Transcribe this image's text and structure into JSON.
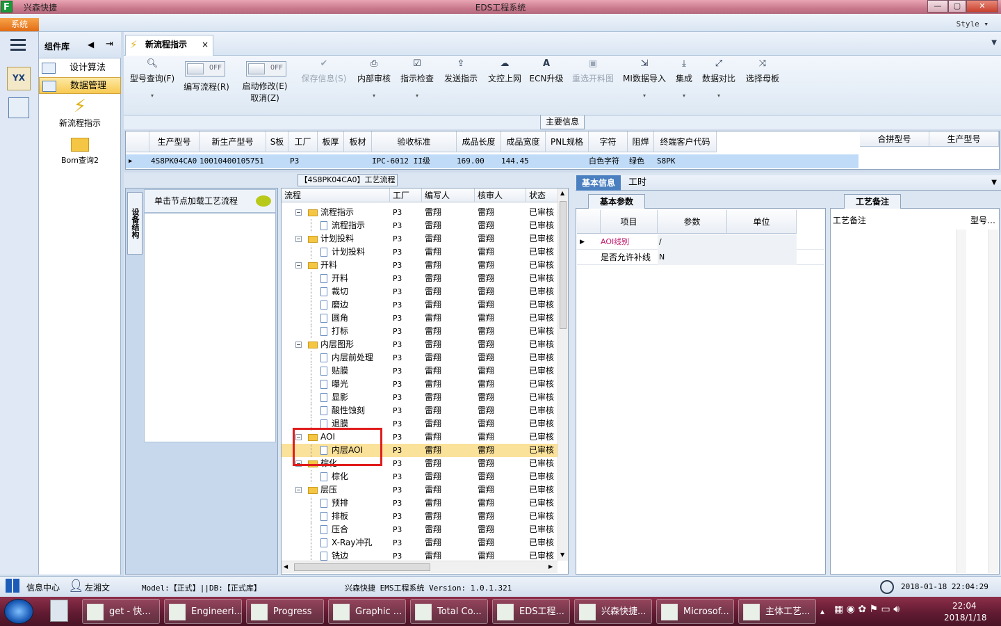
{
  "window": {
    "app_title": "兴森快捷",
    "title": "EDS工程系统",
    "controls": {
      "min": "—",
      "max": "▢",
      "close": "✕"
    }
  },
  "menu": {
    "system": "系统",
    "style": "Style"
  },
  "sidebar": {
    "header": "组件库",
    "items": [
      {
        "label": "设计算法"
      },
      {
        "label": "数据管理"
      }
    ],
    "big_items": [
      {
        "label": "新流程指示"
      },
      {
        "label": "Bom查询2"
      }
    ]
  },
  "tab": {
    "label": "新流程指示",
    "close": "×"
  },
  "toolbar": {
    "buttons": [
      {
        "label": "型号查询(F)",
        "icon": "search-icon",
        "arrow": "▾"
      },
      {
        "label": "编写流程(R)",
        "toggle": "OFF"
      },
      {
        "label": "启动修改(E)",
        "label2": "取消(Z)",
        "toggle": "OFF"
      },
      {
        "label": "保存信息(S)",
        "icon": "check-icon"
      },
      {
        "label": "内部审核",
        "icon": "print-icon",
        "arrow": "▾"
      },
      {
        "label": "指示检查",
        "icon": "checkbox-icon",
        "arrow": "▾"
      },
      {
        "label": "发送指示",
        "icon": "upload-icon"
      },
      {
        "label": "文控上网",
        "icon": "cloud-upload-icon"
      },
      {
        "label": "ECN升级",
        "icon": "font-icon"
      },
      {
        "label": "重选开料图",
        "icon": "image-icon"
      },
      {
        "label": "MI数据导入",
        "icon": "import-icon",
        "arrow": "▾"
      },
      {
        "label": "集成",
        "icon": "download-icon",
        "arrow": "▾"
      },
      {
        "label": "数据对比",
        "icon": "compare-icon",
        "arrow": "▾"
      },
      {
        "label": "选择母板",
        "icon": "shuffle-icon"
      }
    ]
  },
  "main_info": {
    "title": "主要信息",
    "columns": [
      "生产型号",
      "新生产型号",
      "S板",
      "工厂",
      "板厚",
      "板材",
      "验收标准",
      "成品长度",
      "成品宽度",
      "PNL规格",
      "字符",
      "阻焊",
      "终端客户代码"
    ],
    "row": [
      "4S8PK04CA0",
      "10010400105751",
      "",
      "P3",
      "",
      "",
      "IPC-6012 II级",
      "169.00",
      "144.45",
      "",
      "白色字符",
      "绿色",
      "S8PK"
    ],
    "side_columns": [
      "合拼型号",
      "生产型号"
    ]
  },
  "left_pane": {
    "vertical_tab": "设备结构",
    "load_hint": "单击节点加载工艺流程"
  },
  "process": {
    "title": "【4S8PK04CA0】工艺流程",
    "columns": [
      "流程",
      "工厂",
      "编写人",
      "核审人",
      "状态"
    ],
    "rows": [
      {
        "name": "流程指示",
        "level": 0,
        "factory": "P3",
        "writer": "雷翔",
        "reviewer": "雷翔",
        "status": "已审核"
      },
      {
        "name": "流程指示",
        "level": 1,
        "factory": "P3",
        "writer": "雷翔",
        "reviewer": "雷翔",
        "status": "已审核"
      },
      {
        "name": "计划投料",
        "level": 0,
        "factory": "P3",
        "writer": "雷翔",
        "reviewer": "雷翔",
        "status": "已审核"
      },
      {
        "name": "计划投料",
        "level": 1,
        "factory": "P3",
        "writer": "雷翔",
        "reviewer": "雷翔",
        "status": "已审核"
      },
      {
        "name": "开料",
        "level": 0,
        "factory": "P3",
        "writer": "雷翔",
        "reviewer": "雷翔",
        "status": "已审核"
      },
      {
        "name": "开料",
        "level": 1,
        "factory": "P3",
        "writer": "雷翔",
        "reviewer": "雷翔",
        "status": "已审核"
      },
      {
        "name": "裁切",
        "level": 1,
        "factory": "P3",
        "writer": "雷翔",
        "reviewer": "雷翔",
        "status": "已审核"
      },
      {
        "name": "磨边",
        "level": 1,
        "factory": "P3",
        "writer": "雷翔",
        "reviewer": "雷翔",
        "status": "已审核"
      },
      {
        "name": "圆角",
        "level": 1,
        "factory": "P3",
        "writer": "雷翔",
        "reviewer": "雷翔",
        "status": "已审核"
      },
      {
        "name": "打标",
        "level": 1,
        "factory": "P3",
        "writer": "雷翔",
        "reviewer": "雷翔",
        "status": "已审核"
      },
      {
        "name": "内层图形",
        "level": 0,
        "factory": "P3",
        "writer": "雷翔",
        "reviewer": "雷翔",
        "status": "已审核"
      },
      {
        "name": "内层前处理",
        "level": 1,
        "factory": "P3",
        "writer": "雷翔",
        "reviewer": "雷翔",
        "status": "已审核"
      },
      {
        "name": "贴膜",
        "level": 1,
        "factory": "P3",
        "writer": "雷翔",
        "reviewer": "雷翔",
        "status": "已审核"
      },
      {
        "name": "曝光",
        "level": 1,
        "factory": "P3",
        "writer": "雷翔",
        "reviewer": "雷翔",
        "status": "已审核"
      },
      {
        "name": "显影",
        "level": 1,
        "factory": "P3",
        "writer": "雷翔",
        "reviewer": "雷翔",
        "status": "已审核"
      },
      {
        "name": "酸性蚀刻",
        "level": 1,
        "factory": "P3",
        "writer": "雷翔",
        "reviewer": "雷翔",
        "status": "已审核"
      },
      {
        "name": "退膜",
        "level": 1,
        "factory": "P3",
        "writer": "雷翔",
        "reviewer": "雷翔",
        "status": "已审核"
      },
      {
        "name": "AOI",
        "level": 0,
        "factory": "P3",
        "writer": "雷翔",
        "reviewer": "雷翔",
        "status": "已审核"
      },
      {
        "name": "内层AOI",
        "level": 1,
        "factory": "P3",
        "writer": "雷翔",
        "reviewer": "雷翔",
        "status": "已审核",
        "selected": true
      },
      {
        "name": "棕化",
        "level": 0,
        "factory": "P3",
        "writer": "雷翔",
        "reviewer": "雷翔",
        "status": "已审核"
      },
      {
        "name": "棕化",
        "level": 1,
        "factory": "P3",
        "writer": "雷翔",
        "reviewer": "雷翔",
        "status": "已审核"
      },
      {
        "name": "层压",
        "level": 0,
        "factory": "P3",
        "writer": "雷翔",
        "reviewer": "雷翔",
        "status": "已审核"
      },
      {
        "name": "预排",
        "level": 1,
        "factory": "P3",
        "writer": "雷翔",
        "reviewer": "雷翔",
        "status": "已审核"
      },
      {
        "name": "排板",
        "level": 1,
        "factory": "P3",
        "writer": "雷翔",
        "reviewer": "雷翔",
        "status": "已审核"
      },
      {
        "name": "压合",
        "level": 1,
        "factory": "P3",
        "writer": "雷翔",
        "reviewer": "雷翔",
        "status": "已审核"
      },
      {
        "name": "X-Ray冲孔",
        "level": 1,
        "factory": "P3",
        "writer": "雷翔",
        "reviewer": "雷翔",
        "status": "已审核"
      },
      {
        "name": "铣边",
        "level": 1,
        "factory": "P3",
        "writer": "雷翔",
        "reviewer": "雷翔",
        "status": "已审核"
      }
    ]
  },
  "right_tabs": [
    "基本信息",
    "工时"
  ],
  "basic_params": {
    "tab": "基本参数",
    "columns": [
      "项目",
      "参数",
      "单位"
    ],
    "rows": [
      {
        "item": "AOI线别",
        "param": "/",
        "unit": ""
      },
      {
        "item": "是否允许补线",
        "param": "N",
        "unit": ""
      }
    ]
  },
  "notes": {
    "tab": "工艺备注",
    "columns": [
      "工艺备注",
      "型号…"
    ]
  },
  "status": {
    "info_center": "信息中心",
    "user": "左湘文",
    "model": "Model:【正式】||DB:【正式库】",
    "app_version": "兴森快捷 EMS工程系统 Version: 1.0.1.321",
    "datetime": "2018-01-18 22:04:29"
  },
  "taskbar": {
    "items": [
      "get - 快...",
      "Engineeri...",
      "Progress",
      "Graphic ...",
      "Total Co...",
      "EDS工程...",
      "兴森快捷...",
      "Microsof...",
      "主体工艺..."
    ],
    "time": "22:04",
    "date": "2018/1/18"
  },
  "colors": {
    "accent": "#4a7fc0",
    "highlight": "#fbe29a",
    "selection_box": "#e01c1c",
    "system_button": "#e26b13"
  }
}
